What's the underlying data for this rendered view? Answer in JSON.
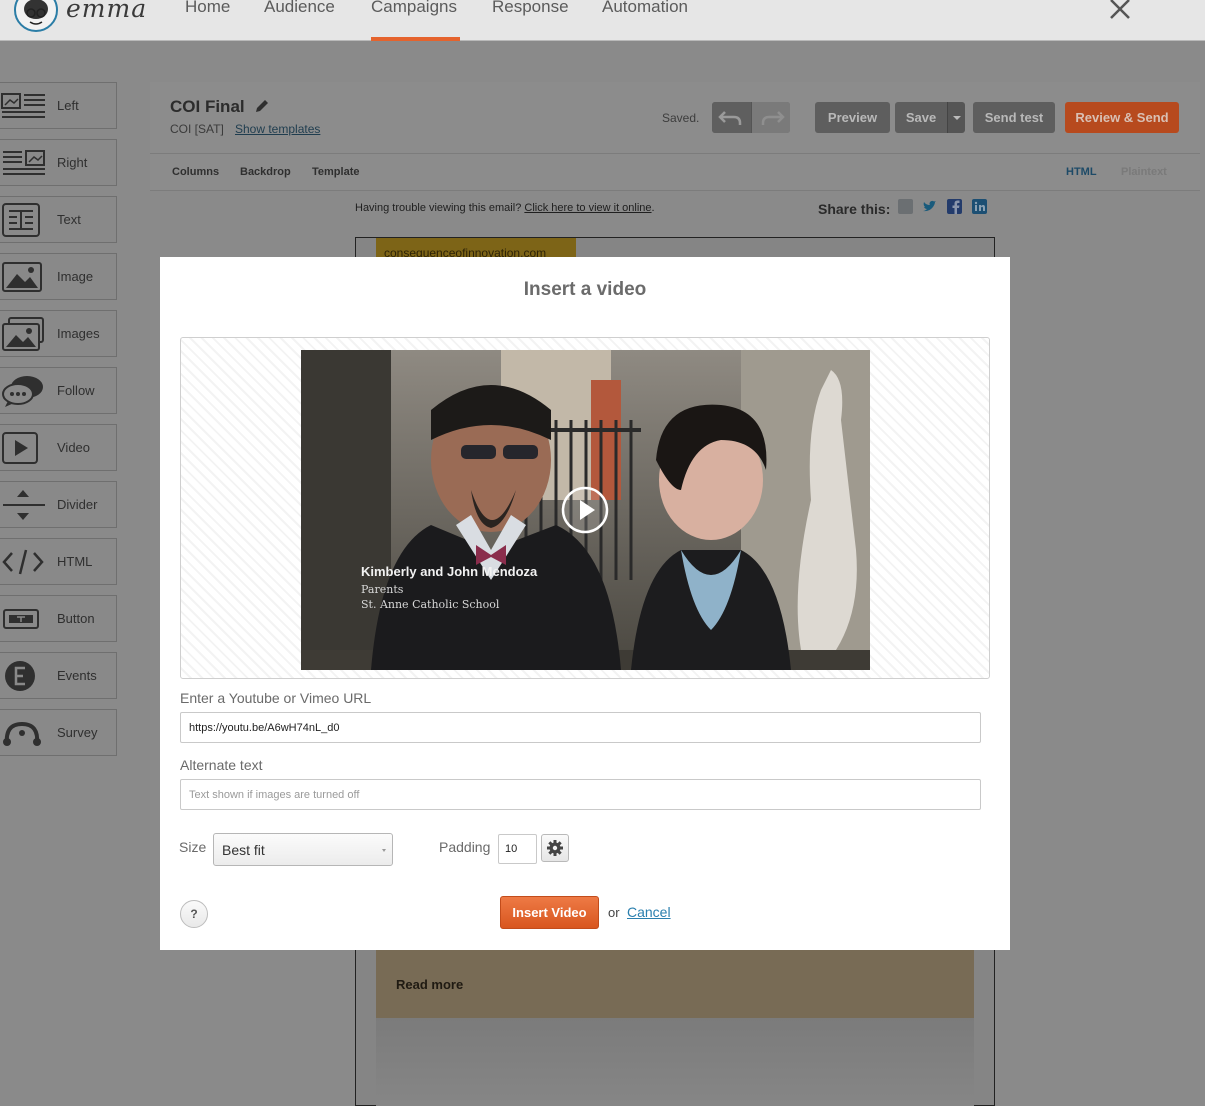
{
  "app": {
    "logo_text": "emma",
    "nav": [
      "Home",
      "Audience",
      "Campaigns",
      "Response",
      "Automation"
    ],
    "active_nav": "Campaigns"
  },
  "sidebar": {
    "blocks": [
      {
        "label": "Left",
        "icon": "layout-left-icon"
      },
      {
        "label": "Right",
        "icon": "layout-right-icon"
      },
      {
        "label": "Text",
        "icon": "text-block-icon"
      },
      {
        "label": "Image",
        "icon": "image-icon"
      },
      {
        "label": "Images",
        "icon": "images-icon"
      },
      {
        "label": "Follow",
        "icon": "speech-bubbles-icon"
      },
      {
        "label": "Video",
        "icon": "play-icon"
      },
      {
        "label": "Divider",
        "icon": "divider-icon"
      },
      {
        "label": "HTML",
        "icon": "code-icon"
      },
      {
        "label": "Button",
        "icon": "button-icon"
      },
      {
        "label": "Events",
        "icon": "events-icon"
      },
      {
        "label": "Survey",
        "icon": "survey-icon"
      }
    ]
  },
  "editor": {
    "campaign_title": "COI Final",
    "campaign_sub": "COI [SAT]",
    "show_templates": "Show templates",
    "saved_status": "Saved.",
    "buttons": {
      "preview": "Preview",
      "save": "Save",
      "send_test": "Send test",
      "review_send": "Review & Send"
    },
    "subtabs": [
      "Columns",
      "Backdrop",
      "Template"
    ],
    "view_tabs": {
      "html": "HTML",
      "plaintext": "Plaintext"
    }
  },
  "email": {
    "trouble_text": "Having trouble viewing this email?",
    "trouble_link": "Click here to view it online",
    "trouble_end": ".",
    "share_label": "Share this:",
    "domain_tag": "consequenceofinnovation.com",
    "read_more": "Read more"
  },
  "modal": {
    "title": "Insert a video",
    "video_caption": {
      "name": "Kimberly and John Mendoza",
      "role": "Parents",
      "school": "St. Anne Catholic School"
    },
    "url_label": "Enter a Youtube or Vimeo URL",
    "url_value": "https://youtu.be/A6wH74nL_d0",
    "alt_label": "Alternate text",
    "alt_placeholder": "Text shown if images are turned off",
    "size_label": "Size",
    "size_value": "Best fit",
    "padding_label": "Padding",
    "padding_value": "10",
    "help_label": "?",
    "insert_label": "Insert Video",
    "or_text": "or",
    "cancel_label": "Cancel"
  },
  "colors": {
    "accent": "#e5632d",
    "link": "#2a7fae",
    "overlay": "#8a8a8a"
  }
}
